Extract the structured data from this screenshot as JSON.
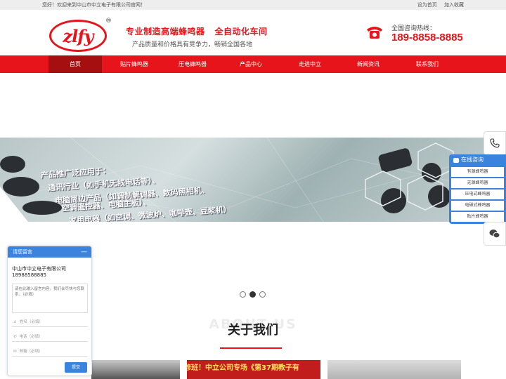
{
  "topbar": {
    "welcome": "您好！欢迎来到中山市中立电子有限公司官网！",
    "links": [
      "设为首页",
      "加入收藏"
    ]
  },
  "header": {
    "logo_text": "zlfy",
    "logo_reg": "®",
    "slogan1": "专业制造高端蜂鸣器   全自动化车间",
    "slogan2": "产品质量和价格具有竞争力，畅销全国各地",
    "hotline_label": "全国咨询热线：",
    "hotline": "189-8858-8885",
    "accent_color": "#e8141b"
  },
  "nav": {
    "items": [
      "首页",
      "贴片蜂鸣器",
      "压电蜂鸣器",
      "产品中心",
      "走进中立",
      "新闻资讯",
      "联系我们"
    ],
    "active_index": 0
  },
  "banner": {
    "lines": [
      "产品推广泛应用于：",
      "通讯行业（如手机无线电话等）、",
      "电脑周边产品（如调制解调器、数码照相机、",
      "        空调遥控器、电脑主板）、",
      "家用电器（如空调、微波炉、咖啡壶、豆浆机）"
    ],
    "slide_count": 3,
    "active_slide": 1
  },
  "about": {
    "ghost": "ABOUT US",
    "title": "关于我们",
    "photo_marquee": "修班！中立公司专场《第37期教子有"
  },
  "right_float": {
    "consult_title": "在线咨询",
    "consult_items": [
      "有源蜂鸣器",
      "无源蜂鸣器",
      "压电式蜂鸣器",
      "电磁式蜂鸣器",
      "贴片蜂鸣器"
    ],
    "consult_color": "#3a84e0"
  },
  "message": {
    "title": "请您留言",
    "minimize": "—",
    "company": "中山市中立电子有限公司",
    "phone": "18988588885",
    "textarea_placeholder": "请在此输入留言内容，我们会尽快与您联系。（必填）",
    "name_placeholder": "姓名（必填）",
    "tel_placeholder": "电话（必填）",
    "email_placeholder": "邮箱（必填）",
    "submit": "提交"
  }
}
